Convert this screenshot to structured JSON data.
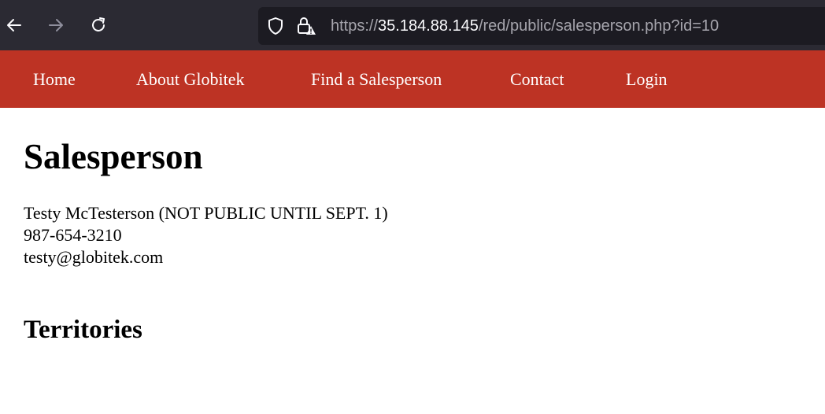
{
  "browser": {
    "back_icon": "arrow-left-icon",
    "forward_icon": "arrow-right-icon",
    "reload_icon": "reload-icon",
    "shield_icon": "shield-icon",
    "lock_icon": "lock-warning-icon",
    "url_prefix": "https://",
    "url_host": "35.184.88.145",
    "url_path": "/red/public/salesperson.php?id=10"
  },
  "nav": {
    "items": [
      {
        "label": "Home"
      },
      {
        "label": "About Globitek"
      },
      {
        "label": "Find a Salesperson"
      },
      {
        "label": "Contact"
      },
      {
        "label": "Login"
      }
    ],
    "background_color": "#bd3324"
  },
  "page": {
    "title": "Salesperson",
    "salesperson": {
      "name": "Testy McTesterson (NOT PUBLIC UNTIL SEPT. 1)",
      "phone": "987-654-3210",
      "email": "testy@globitek.com"
    },
    "territories_heading": "Territories"
  }
}
